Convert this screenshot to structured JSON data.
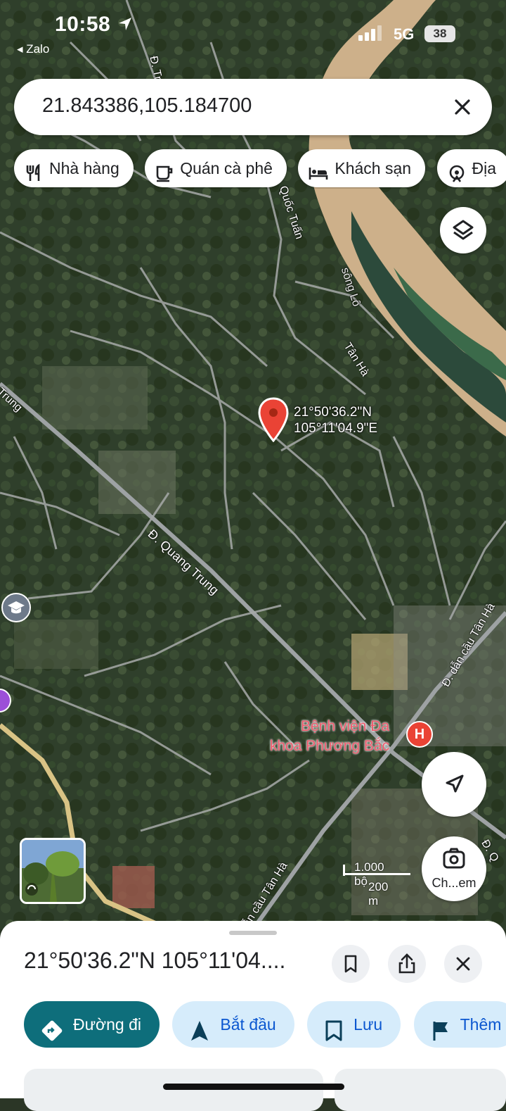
{
  "status_bar": {
    "time": "10:58",
    "back_app": "◂ Zalo",
    "network": "5G",
    "battery": "38"
  },
  "search": {
    "value": "21.843386,105.184700"
  },
  "chips": [
    {
      "icon": "fork-knife-icon",
      "label": "Nhà hàng"
    },
    {
      "icon": "coffee-cup-icon",
      "label": "Quán cà phê"
    },
    {
      "icon": "bed-icon",
      "label": "Khách sạn"
    },
    {
      "icon": "attraction-icon",
      "label": "Địa"
    }
  ],
  "map": {
    "labels": {
      "road_tran": "Đ. Trần",
      "road_quoc_tuan": "Quốc Tuấn",
      "river": "sông Lô",
      "tan_ha": "Tân Hà",
      "road_trung": "Trung",
      "road_quang_trung": "Đ. Quang Trung",
      "road_dan_cau_tan_ha": "Đ. dẫn cầu Tân Hà",
      "road_cau_tan_ha_bottom": "dẫn cầu Tân Hà",
      "road_q": "Đ. Q"
    },
    "pin": {
      "lat": "21°50'36.2\"N",
      "lng": "105°11'04.9\"E"
    },
    "hospital": {
      "line1": "Bệnh viện Đa",
      "line2": "khoa Phương Bắc",
      "icon_text": "H"
    },
    "scale": {
      "imperial": "1.000 bộ",
      "metric": "200 m"
    },
    "lens_label": "Ch...em"
  },
  "sheet": {
    "title": "21°50'36.2\"N 105°11'04....",
    "actions": [
      {
        "icon": "directions-icon",
        "label": "Đường đi"
      },
      {
        "icon": "navigation-arrow-icon",
        "label": "Bắt đầu"
      },
      {
        "icon": "bookmark-icon",
        "label": "Lưu"
      },
      {
        "icon": "flag-icon",
        "label": "Thêm"
      }
    ]
  },
  "colors": {
    "primary_action": "#0e6e7b",
    "secondary_action": "#d6ecfb",
    "pin": "#ea4335",
    "hospital_text": "#ef5b6e"
  }
}
